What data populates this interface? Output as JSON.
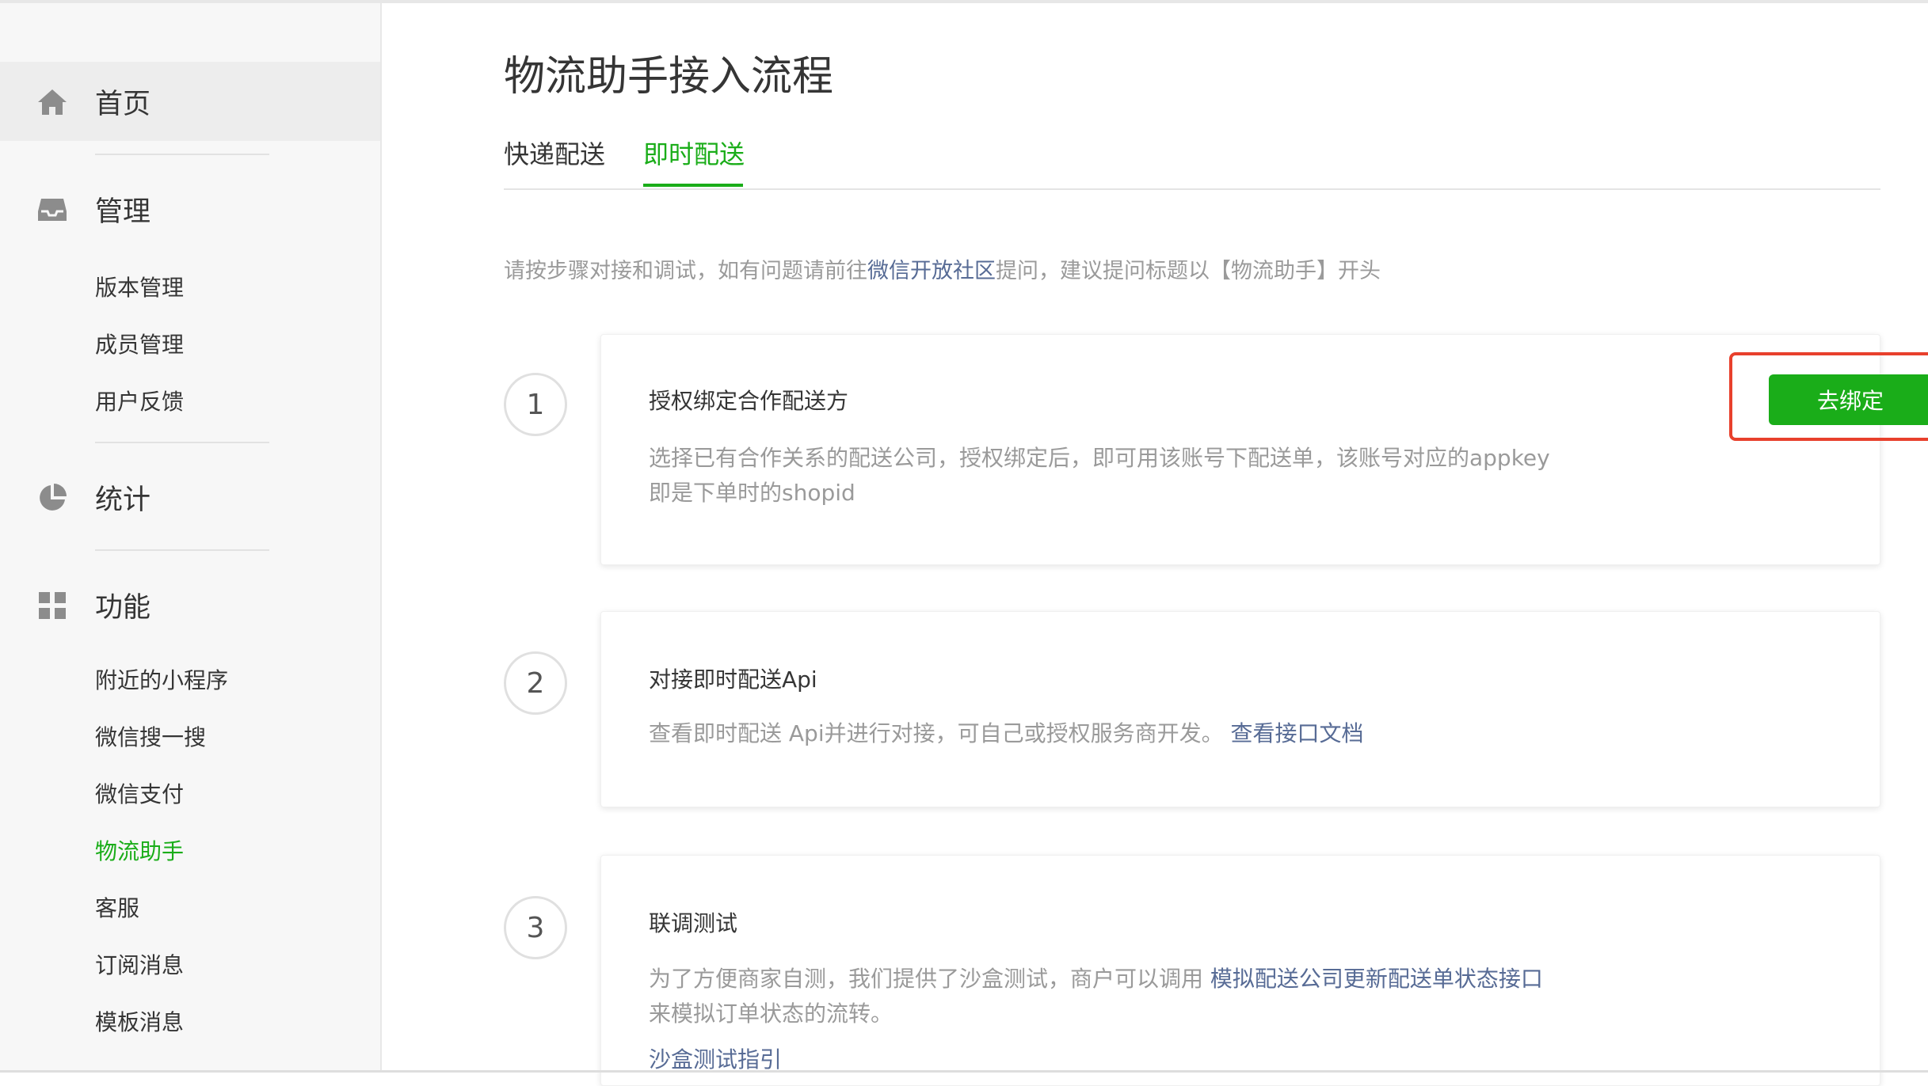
{
  "sidebar": {
    "home": {
      "label": "首页",
      "icon": "home-icon"
    },
    "manage": {
      "label": "管理",
      "icon": "inbox-icon",
      "items": [
        "版本管理",
        "成员管理",
        "用户反馈"
      ]
    },
    "stats": {
      "label": "统计",
      "icon": "pie-chart-icon"
    },
    "features": {
      "label": "功能",
      "icon": "grid-icon",
      "items": [
        "附近的小程序",
        "微信搜一搜",
        "微信支付",
        "物流助手",
        "客服",
        "订阅消息",
        "模板消息"
      ],
      "active_item": "物流助手"
    }
  },
  "main": {
    "title": "物流助手接入流程",
    "tabs": [
      {
        "label": "快递配送",
        "active": false
      },
      {
        "label": "即时配送",
        "active": true
      }
    ],
    "hint": {
      "before": "请按步骤对接和调试，如有问题请前往",
      "link": "微信开放社区",
      "after": "提问，建议提问标题以【物流助手】开头"
    },
    "steps": [
      {
        "num": "1",
        "title": "授权绑定合作配送方",
        "desc_line1": "选择已有合作关系的配送公司，授权绑定后，即可用该账号下配送单，该账号对应的appkey",
        "desc_line2": "即是下单时的shopid",
        "button": "去绑定"
      },
      {
        "num": "2",
        "title": "对接即时配送Api",
        "desc": "查看即时配送 Api并进行对接，可自己或授权服务商开发。",
        "link": "查看接口文档"
      },
      {
        "num": "3",
        "title": "联调测试",
        "desc_line1": "为了方便商家自测，我们提供了沙盒测试，商户可以调用 ",
        "link1": "模拟配送公司更新配送单状态接口",
        "desc_line2": "来模拟订单状态的流转。",
        "link2": "沙盒测试指引"
      }
    ]
  },
  "colors": {
    "accent": "#1aad19",
    "link": "#576b95",
    "highlight": "#e8402c"
  }
}
